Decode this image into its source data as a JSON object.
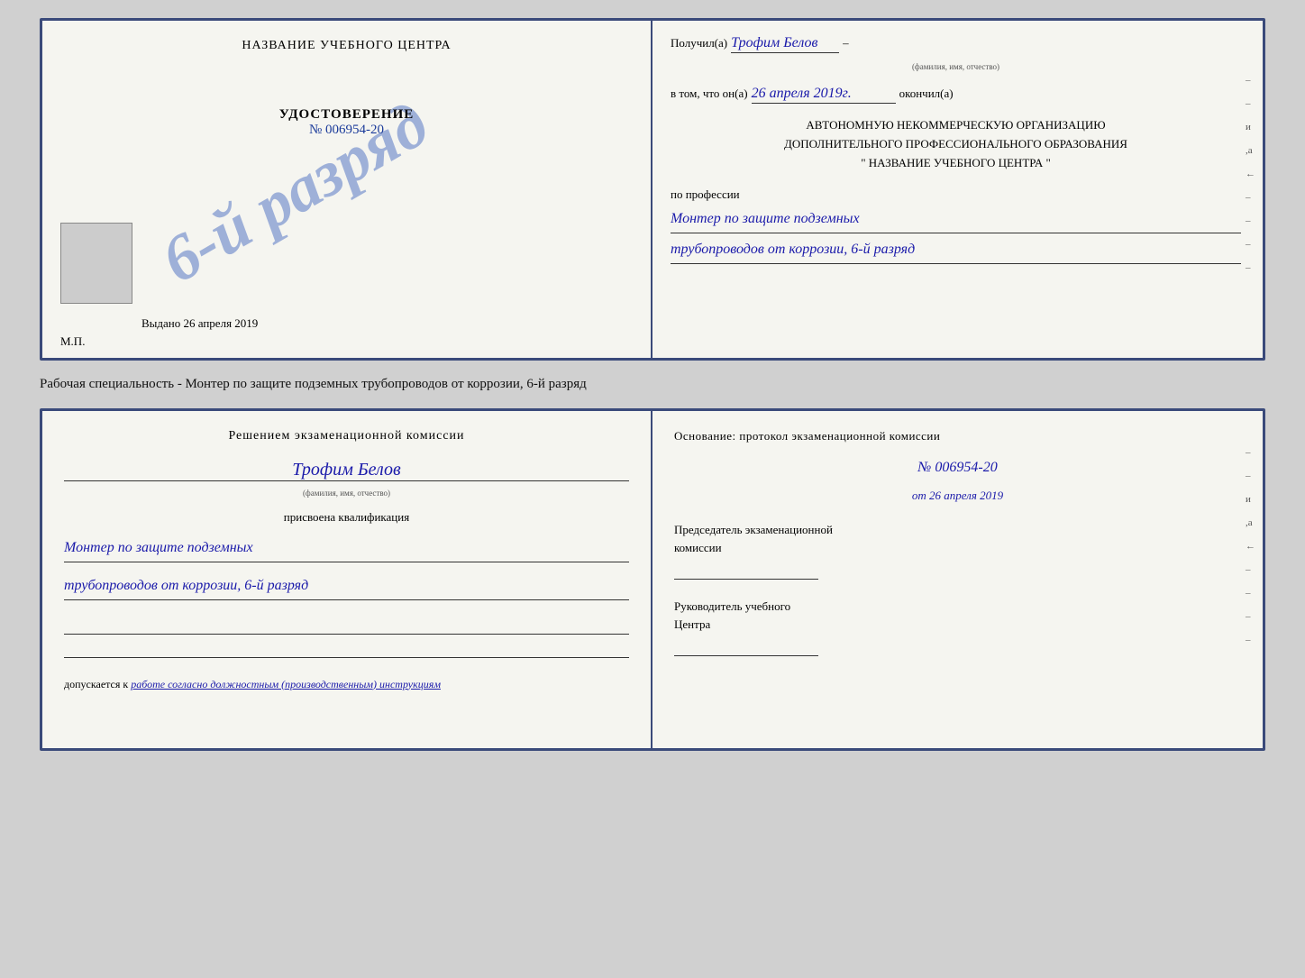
{
  "page": {
    "background": "#d0d0d0"
  },
  "cert_top": {
    "left": {
      "school_title": "НАЗВАНИЕ УЧЕБНОГО ЦЕНТРА",
      "stamp_text": "6-й разряд",
      "udost_label": "УДОСТОВЕРЕНИЕ",
      "udost_number": "№ 006954-20",
      "issued_label": "Выдано",
      "issued_date": "26 апреля 2019",
      "mp_label": "М.П."
    },
    "right": {
      "received_label": "Получил(а)",
      "received_name": "Трофим Белов",
      "name_subtext": "(фамилия, имя, отчество)",
      "dash1": "–",
      "in_that_label": "в том, что он(а)",
      "completion_date": "26 апреля 2019г.",
      "finished_label": "окончил(а)",
      "org_line1": "АВТОНОМНУЮ НЕКОММЕРЧЕСКУЮ ОРГАНИЗАЦИЮ",
      "org_line2": "ДОПОЛНИТЕЛЬНОГО ПРОФЕССИОНАЛЬНОГО ОБРАЗОВАНИЯ",
      "org_line3": "\"   НАЗВАНИЕ УЧЕБНОГО ЦЕНТРА   \"",
      "deco_i": "и",
      "deco_a": ",а",
      "deco_left": "←",
      "profession_label": "по профессии",
      "profession_line1": "Монтер по защите подземных",
      "profession_line2": "трубопроводов от коррозии, 6-й разряд"
    }
  },
  "middle_text": "Рабочая специальность - Монтер по защите подземных трубопроводов от коррозии, 6-й разряд",
  "cert_bottom": {
    "left": {
      "decision_title": "Решением экзаменационной комиссии",
      "person_name": "Трофим Белов",
      "name_subtext": "(фамилия, имя, отчество)",
      "assigned_label": "присвоена квалификация",
      "qual_line1": "Монтер по защите подземных",
      "qual_line2": "трубопроводов от коррозии, 6-й разряд",
      "допускается_prefix": "допускается к",
      "допускается_text": "работе согласно должностным (производственным) инструкциям"
    },
    "right": {
      "osnov_title": "Основание: протокол экзаменационной комиссии",
      "protocol_number": "№ 006954-20",
      "date_prefix": "от",
      "protocol_date": "26 апреля 2019",
      "chairman_title_line1": "Председатель экзаменационной",
      "chairman_title_line2": "комиссии",
      "head_title_line1": "Руководитель учебного",
      "head_title_line2": "Центра",
      "deco_i": "и",
      "deco_a": ",а",
      "deco_left": "←"
    }
  }
}
